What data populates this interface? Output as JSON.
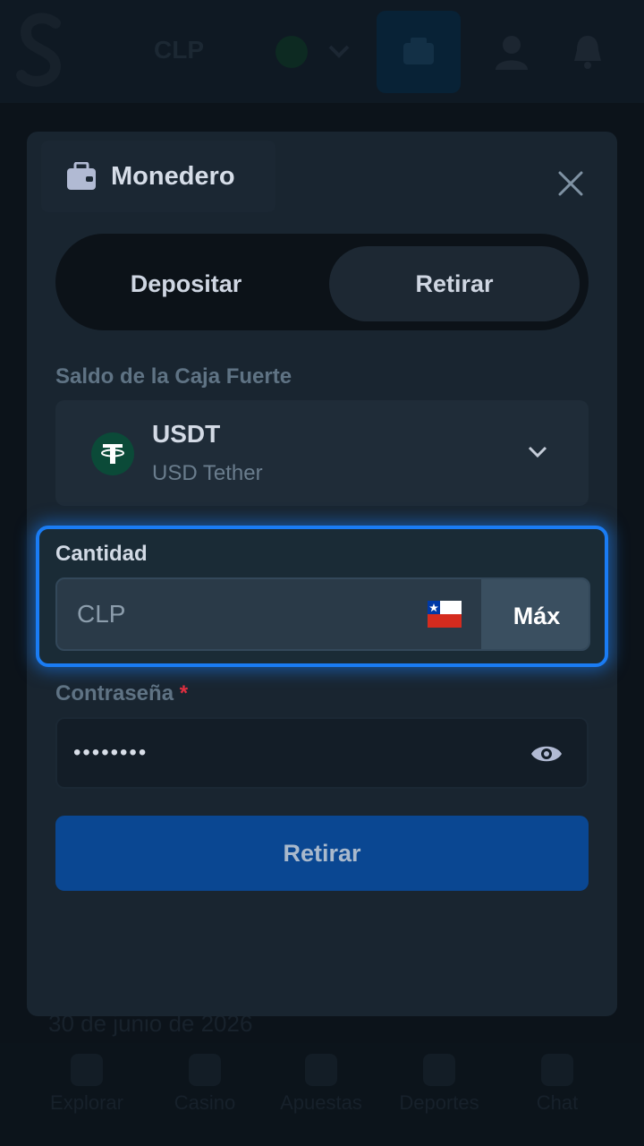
{
  "topbar": {
    "currency": "CLP"
  },
  "background": {
    "date": "30 de junio de 2026",
    "nav": [
      {
        "label": "Explorar",
        "icon": "search-icon"
      },
      {
        "label": "Casino",
        "icon": "casino-icon"
      },
      {
        "label": "Apuestas",
        "icon": "bets-icon"
      },
      {
        "label": "Deportes",
        "icon": "sports-icon"
      },
      {
        "label": "Chat",
        "icon": "chat-icon"
      }
    ]
  },
  "modal": {
    "title": "Monedero",
    "tabs": {
      "deposit": "Depositar",
      "withdraw": "Retirar",
      "active": "withdraw"
    },
    "balance_label": "Saldo de la Caja Fuerte",
    "coin": {
      "code": "USDT",
      "name": "USD Tether",
      "color": "#0b4a38"
    },
    "amount": {
      "label": "Cantidad",
      "placeholder": "CLP",
      "max_label": "Máx",
      "flag": "chile-flag-icon"
    },
    "password": {
      "label": "Contraseña",
      "required_mark": "*",
      "value": "••••••••"
    },
    "submit_label": "Retirar"
  },
  "colors": {
    "accent": "#1a7cf4",
    "primary_button": "#0a4792",
    "required": "#e02f40"
  }
}
